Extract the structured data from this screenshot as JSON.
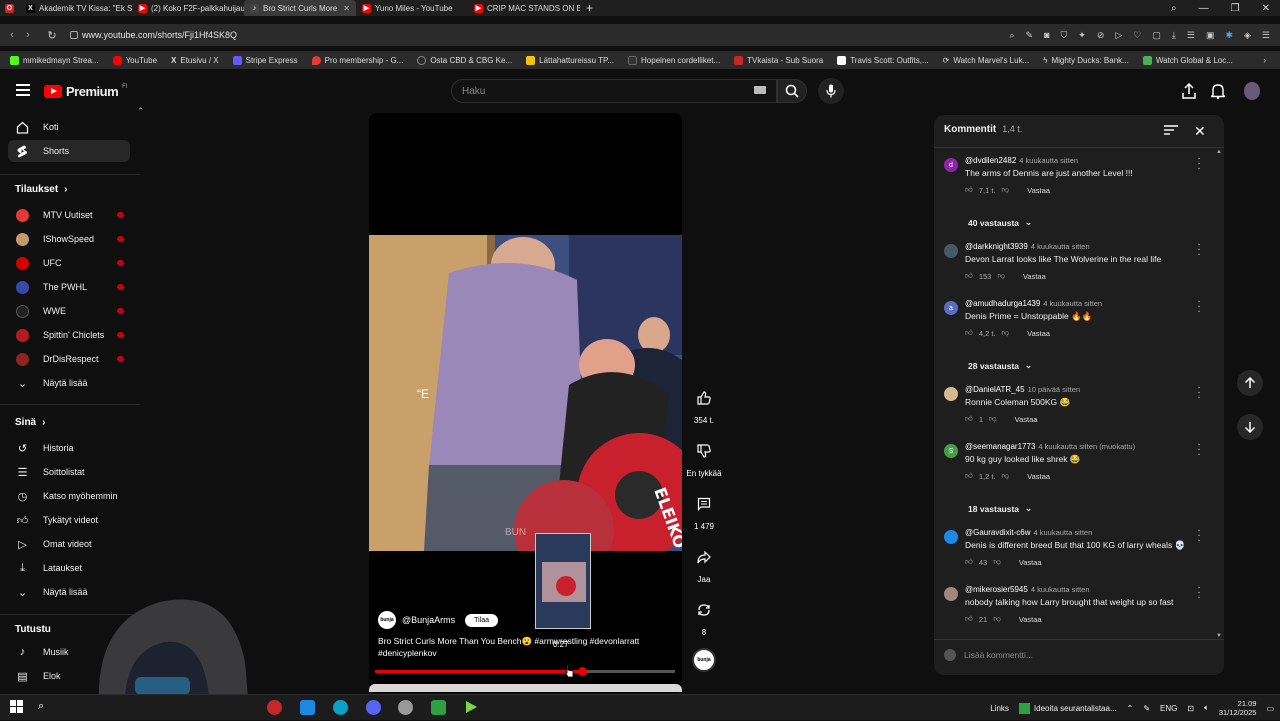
{
  "browser": {
    "tabs": [
      {
        "label": "Akademik TV Kissa: \"Ek Si",
        "icon": "x-icon",
        "color": "#000000"
      },
      {
        "label": "(2) Koko F2F-palkkahuijaus",
        "icon": "youtube-icon",
        "color": "#ff0000"
      },
      {
        "label": "Bro Strict Curls More",
        "icon": "youtube-icon",
        "color": "#ff0000",
        "active": true
      },
      {
        "label": "Yuno Miles - YouTube",
        "icon": "youtube-icon",
        "color": "#ff0000"
      },
      {
        "label": "CRIP MAC STANDS ON BU",
        "icon": "youtube-icon",
        "color": "#ff0000"
      }
    ],
    "url": "www.youtube.com/shorts/Fji1Hf4SK8Q",
    "bookmarks": [
      {
        "label": "mmikedmayn Strea...",
        "color": "#53fc18"
      },
      {
        "label": "YouTube",
        "color": "#ff0000"
      },
      {
        "label": "Etusivu / X",
        "color": "#000000"
      },
      {
        "label": "Stripe Express",
        "color": "#635bff"
      },
      {
        "label": "Pro membership - G...",
        "color": "#e53935"
      },
      {
        "label": "Osta CBD & CBG Ke...",
        "color": "#888888"
      },
      {
        "label": "Lättahattureissu TP...",
        "color": "#f4c20d"
      },
      {
        "label": "Hopeinen cordelliket...",
        "color": "#333333"
      },
      {
        "label": "TVkaista - Sub Suora",
        "color": "#c62828"
      },
      {
        "label": "Travis Scott: Outfits,...",
        "color": "#ffffff"
      },
      {
        "label": "Watch Marvel's Luk...",
        "color": "#cccccc"
      },
      {
        "label": "Mighty Ducks: Bank...",
        "color": "#dddddd"
      },
      {
        "label": "Watch Global & Loc...",
        "color": "#4caf50"
      }
    ]
  },
  "header": {
    "logo": "Premium",
    "logo_sup": "FI",
    "search_placeholder": "Haku"
  },
  "sidebar": {
    "main": [
      {
        "label": "Koti",
        "icon": "home-icon"
      },
      {
        "label": "Shorts",
        "icon": "shorts-icon",
        "active": true
      }
    ],
    "subs_title": "Tilaukset",
    "subs": [
      {
        "label": "MTV Uutiset",
        "color": "#e53935"
      },
      {
        "label": "IShowSpeed",
        "color": "#c49a6c"
      },
      {
        "label": "UFC",
        "color": "#d50000"
      },
      {
        "label": "The PWHL",
        "color": "#3949ab"
      },
      {
        "label": "WWE",
        "color": "#222222"
      },
      {
        "label": "Spittin' Chiclets",
        "color": "#b71c1c"
      },
      {
        "label": "DrDisRespect",
        "color": "#8e2424"
      }
    ],
    "show_more": "Näytä lisää",
    "you_title": "Sinä",
    "you": [
      {
        "label": "Historia",
        "icon": "history-icon"
      },
      {
        "label": "Soittolistat",
        "icon": "playlist-icon"
      },
      {
        "label": "Katso myöhemmin",
        "icon": "clock-icon"
      },
      {
        "label": "Tykätyt videot",
        "icon": "like-icon"
      },
      {
        "label": "Omat videot",
        "icon": "video-icon"
      },
      {
        "label": "Lataukset",
        "icon": "download-icon"
      }
    ],
    "show_more_2": "Näytä lisää",
    "explore_title": "Tutustu",
    "explore": [
      {
        "label": "Musiik",
        "icon": "music-icon"
      },
      {
        "label": "Elok",
        "icon": "film-icon"
      }
    ]
  },
  "video": {
    "overlay_text": "“E",
    "watermark": "BUN",
    "channel_logo": "bunja",
    "channel": "@BunjaArms",
    "subscribe": "Tilaa",
    "title": "Bro Strict Curls More Than You Bench😮 #armwrestling #devonlarratt #denicyplenkov",
    "thumb_time": "0:27",
    "progress": 0.69
  },
  "actions": {
    "likes": "354 t.",
    "dislike": "En tykkää",
    "comments": "1 479",
    "share": "Jaa",
    "remix": "8",
    "channel_logo": "bunja"
  },
  "comments": {
    "title": "Kommentit",
    "count": "1,4 t.",
    "add_placeholder": "Lisää kommentti...",
    "items": [
      {
        "user": "@dvdilen2482",
        "time": "4 kuukautta sitten",
        "text": "The arms of Dennis are just another Level !!!",
        "likes": "7,1 t.",
        "reply": "Vastaa",
        "avatar": "d",
        "color": "#8e24aa",
        "replies": "40 vastausta"
      },
      {
        "user": "@darkknight3939",
        "time": "4 kuukautta sitten",
        "text": "Devon Larrat looks like The Wolverine in the real life",
        "likes": "153",
        "reply": "Vastaa",
        "avatar": "",
        "color": "#455a64"
      },
      {
        "user": "@amudhadurga1439",
        "time": "4 kuukautta sitten",
        "text": "Denis Prime = Unstoppable 🔥🔥",
        "likes": "4,2 t.",
        "reply": "Vastaa",
        "avatar": "a",
        "color": "#5c6bc0",
        "replies": "28 vastausta"
      },
      {
        "user": "@DanielATR_45",
        "time": "10 päivää sitten",
        "text": "Ronnie Coleman 500KG 😂",
        "likes": "1",
        "reply": "Vastaa",
        "avatar": "",
        "color": "#d7b98e"
      },
      {
        "user": "@seemanagar1773",
        "time": "4 kuukautta sitten (muokattu)",
        "text": "90 kg guy looked like shrek 😂",
        "likes": "1,2 t.",
        "reply": "Vastaa",
        "avatar": "S",
        "color": "#43a047",
        "replies": "18 vastausta"
      },
      {
        "user": "@Gauravdixit-c6w",
        "time": "4 kuukautta sitten",
        "text": "Denis is different breed But that 100 KG of larry wheals 💀",
        "likes": "43",
        "reply": "Vastaa",
        "avatar": "",
        "color": "#1e88e5"
      },
      {
        "user": "@mikerosier5945",
        "time": "4 kuukautta sitten",
        "text": "nobody talking how Larry brought that weight up so fast",
        "likes": "21",
        "reply": "Vastaa",
        "avatar": "",
        "color": "#a1887f"
      }
    ]
  },
  "taskbar": {
    "links": "Links",
    "app": "Ideoita seurantalistaa...",
    "lang": "ENG",
    "time": "21.09",
    "date": "31/12/2025"
  }
}
